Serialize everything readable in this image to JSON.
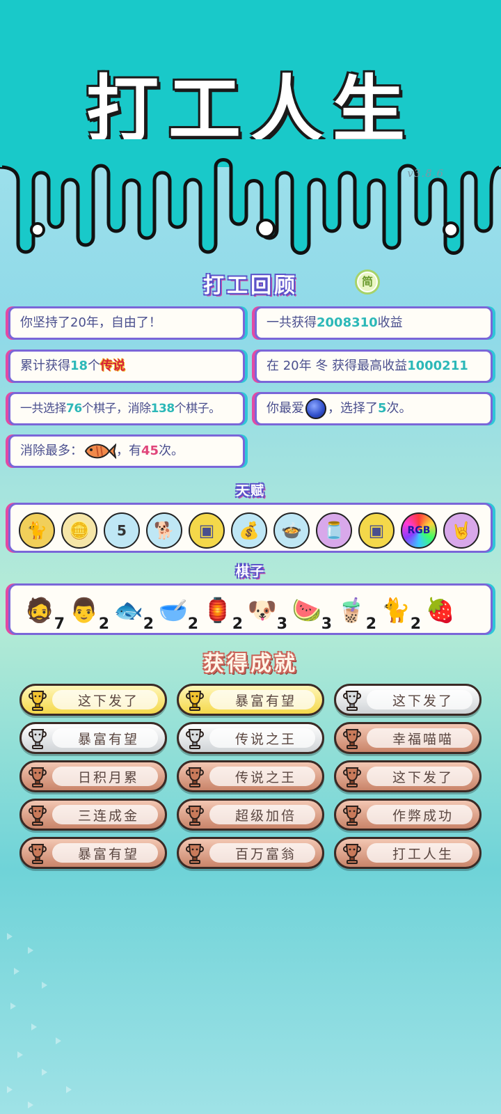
{
  "header": {
    "title": "打工人生",
    "version": "v3.8.6"
  },
  "review": {
    "title": "打工回顾",
    "simp_badge": "简",
    "stats": {
      "s1": {
        "pre": "你坚持了",
        "num": "20",
        "post": "年，自由了！"
      },
      "s2": {
        "pre": "一共获得",
        "num": "2008310",
        "post": "收益"
      },
      "s3": {
        "pre": "累计获得",
        "num": "18",
        "mid": "个",
        "legend": "传说"
      },
      "s4": {
        "pre": "在 20年 冬 获得最高收益",
        "num": "1000211"
      },
      "s5": {
        "pre": "一共选择",
        "num1": "76",
        "mid": "个棋子，消除",
        "num2": "138",
        "post": "个棋子。"
      },
      "s6": {
        "pre": "你最爱",
        "post": "，选择了",
        "num": "5",
        "tail": "次。"
      },
      "s7": {
        "pre": "消除最多：",
        "post": "，有",
        "num": "45",
        "tail": "次。"
      }
    }
  },
  "talents": {
    "title": "天赋",
    "items": [
      {
        "icon": "cat-coin-icon",
        "glyph": "🐈",
        "bg": "#f1cf5a"
      },
      {
        "icon": "coin-stack-icon",
        "glyph": "🪙",
        "bg": "#f6e6a8"
      },
      {
        "icon": "calendar-icon",
        "glyph": "5",
        "bg": "#bfe7f5"
      },
      {
        "icon": "husky-coin-icon",
        "glyph": "🐕",
        "bg": "#bfe7f5"
      },
      {
        "icon": "chip-card-icon",
        "glyph": "▣",
        "bg": "#f4d84a"
      },
      {
        "icon": "money-bag-icon",
        "glyph": "💰",
        "bg": "#bfe7f5"
      },
      {
        "icon": "pot-duck-icon",
        "glyph": "🍲",
        "bg": "#bfe7f5"
      },
      {
        "icon": "jar-icon",
        "glyph": "🫙",
        "bg": "#d8a8ea"
      },
      {
        "icon": "chip-card-icon",
        "glyph": "▣",
        "bg": "#f4d84a"
      },
      {
        "icon": "rgb-icon",
        "glyph": "RGB",
        "bg": "#ff4a4a"
      },
      {
        "icon": "rock-hand-icon",
        "glyph": "🤘",
        "bg": "#d8a8ea"
      }
    ]
  },
  "pieces": {
    "title": "棋子",
    "items": [
      {
        "icon": "worker-man-icon",
        "glyph": "🧔",
        "count": "7"
      },
      {
        "icon": "suit-man-icon",
        "glyph": "👨",
        "count": "2"
      },
      {
        "icon": "koi-fish-icon",
        "glyph": "🐟",
        "count": "2"
      },
      {
        "icon": "bowl-icon",
        "glyph": "🥣",
        "count": "2"
      },
      {
        "icon": "lantern-house-icon",
        "glyph": "🏮",
        "count": "2"
      },
      {
        "icon": "king-husky-icon",
        "glyph": "🐶",
        "count": "3"
      },
      {
        "icon": "watermelon-icon",
        "glyph": "🍉",
        "count": "3"
      },
      {
        "icon": "milk-tea-icon",
        "glyph": "🧋",
        "count": "2"
      },
      {
        "icon": "cat-icon",
        "glyph": "🐈",
        "count": "2"
      },
      {
        "icon": "lychee-icon",
        "glyph": "🍓",
        "count": ""
      }
    ]
  },
  "achievements": {
    "title": "获得成就",
    "items": [
      {
        "label": "这下发了",
        "tier": "gold"
      },
      {
        "label": "暴富有望",
        "tier": "gold"
      },
      {
        "label": "这下发了",
        "tier": "silver"
      },
      {
        "label": "暴富有望",
        "tier": "silver"
      },
      {
        "label": "传说之王",
        "tier": "silver"
      },
      {
        "label": "幸福喵喵",
        "tier": "bronze"
      },
      {
        "label": "日积月累",
        "tier": "bronze"
      },
      {
        "label": "传说之王",
        "tier": "bronze"
      },
      {
        "label": "这下发了",
        "tier": "bronze"
      },
      {
        "label": "三连成金",
        "tier": "bronze"
      },
      {
        "label": "超级加倍",
        "tier": "bronze"
      },
      {
        "label": "作弊成功",
        "tier": "bronze"
      },
      {
        "label": "暴富有望",
        "tier": "bronze"
      },
      {
        "label": "百万富翁",
        "tier": "bronze"
      },
      {
        "label": "打工人生",
        "tier": "bronze"
      }
    ]
  },
  "colors": {
    "header_bg": "#19c9c9",
    "card_border": "#7a66d8",
    "accent_pink": "#e24aa3",
    "accent_teal": "#2ec6d8",
    "number": "#2cb8b8"
  }
}
